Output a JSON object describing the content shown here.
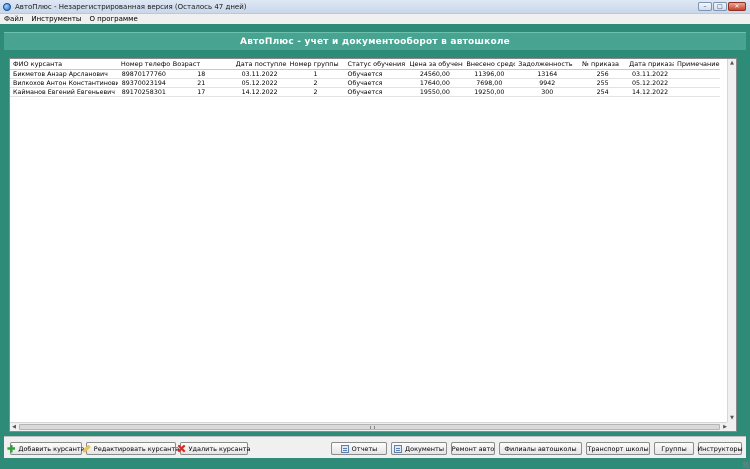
{
  "window": {
    "title": "АвтоПлюс - Незарегистрированная версия (Осталось 47 дней)",
    "controls": {
      "minimize": "–",
      "maximize": "□",
      "close": "✕"
    }
  },
  "menu": {
    "items": [
      "Файл",
      "Инструменты",
      "О программе"
    ]
  },
  "header": {
    "title": "АвтоПлюс - учет и документооборот в автошколе"
  },
  "grid": {
    "columns": [
      "ФИО курсанта",
      "Номер телефона",
      "Возраст",
      "Дата поступления",
      "Номер группы",
      "Статус обучения",
      "Цена за обучение",
      "Внесено средств",
      "Задолженность",
      "№ приказа",
      "Дата приказа",
      "Примечание"
    ],
    "rows": [
      [
        "Бикметов Анзар Арсланович",
        "89870177760",
        "18",
        "03.11.2022",
        "1",
        "Обучается",
        "24560,00",
        "11396,00",
        "13164",
        "256",
        "03.11.2022",
        ""
      ],
      [
        "Вилкохов Антон Константинович",
        "89370023194",
        "21",
        "05.12.2022",
        "2",
        "Обучается",
        "17640,00",
        "7698,00",
        "9942",
        "255",
        "05.12.2022",
        ""
      ],
      [
        "Кайманов Евгений Евгеньевич",
        "89170258301",
        "17",
        "14.12.2022",
        "2",
        "Обучается",
        "19550,00",
        "19250,00",
        "300",
        "254",
        "14.12.2022",
        ""
      ]
    ]
  },
  "toolbar": {
    "add_student": "Добавить курсанта",
    "edit_student": "Редактировать курсанта",
    "delete_student": "Удалить курсанта",
    "reports": "Отчеты",
    "documents": "Документы",
    "car_repair": "Ремонт авто",
    "branches": "Филиалы автошколы",
    "transport": "Транспорт школы",
    "groups": "Группы",
    "instructors": "Инструкторы"
  },
  "icons": {
    "add": "plus-icon",
    "edit": "pencil-icon",
    "delete": "cross-icon",
    "reports": "document-icon",
    "documents": "document-icon"
  },
  "colors": {
    "background": "#2e8b78",
    "header_band": "#48a391",
    "header_text": "#ffffff"
  }
}
